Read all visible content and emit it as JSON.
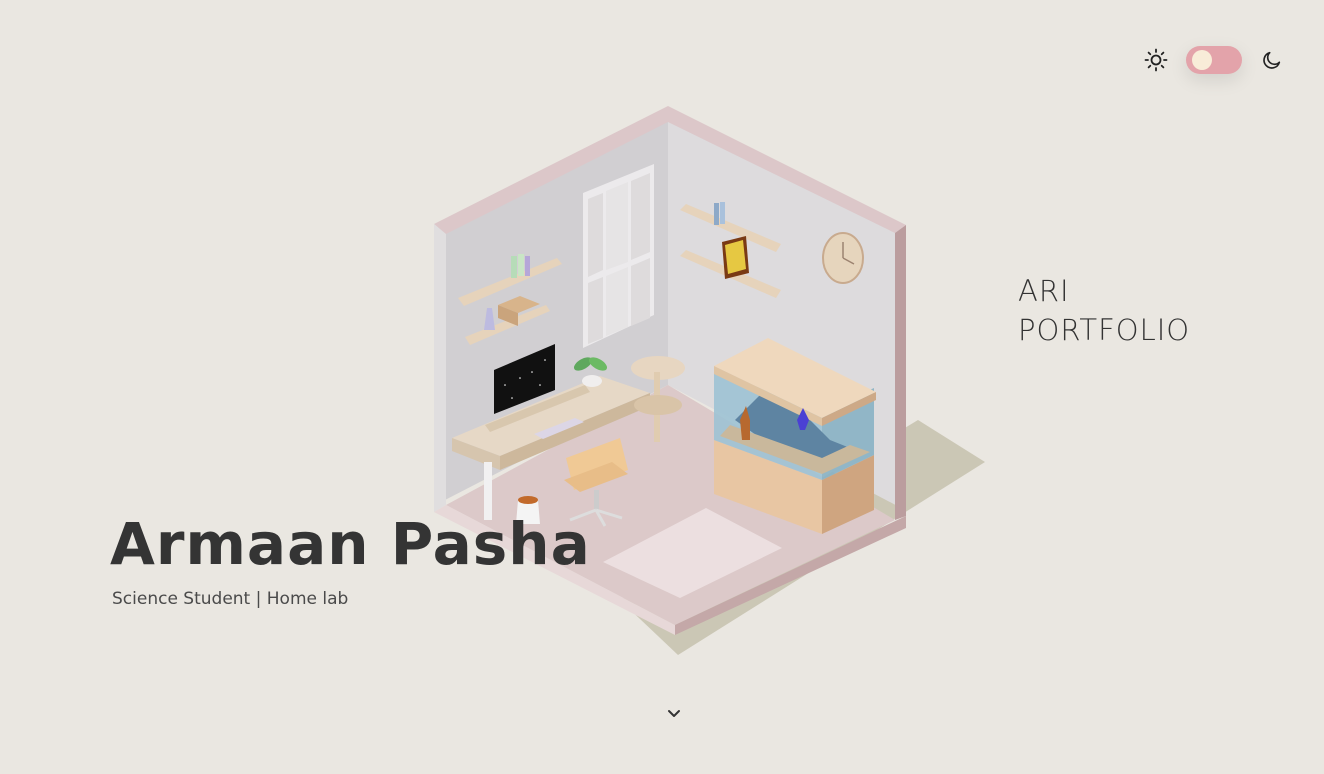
{
  "hero": {
    "name": "Armaan Pasha",
    "subtitle": "Science Student | Home lab"
  },
  "side_label": {
    "line1": "ARI",
    "line2": "PORTFOLIO"
  },
  "theme_toggle": {
    "light_icon": "sun-icon",
    "dark_icon": "moon-icon",
    "mode": "light"
  },
  "scroll_indicator": {
    "icon": "chevron-down-icon"
  },
  "colors": {
    "background": "#eae7e1",
    "toggle_track": "#e3a3aa",
    "toggle_knob": "#f8ecd8",
    "text_dark": "#343434",
    "room_trim": "#d8c2c4",
    "floor": "#dcc9c9",
    "wood": "#e6d3bb"
  }
}
